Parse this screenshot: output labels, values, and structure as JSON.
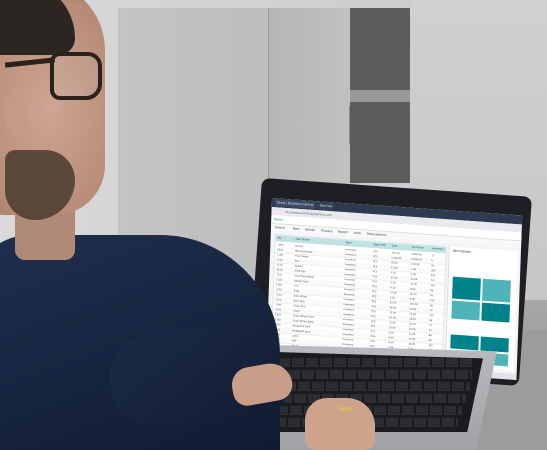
{
  "screen": {
    "browser": {
      "tabs": [
        "Items | Business Central",
        "New tab"
      ],
      "address": "businesscentral.dynamics.com"
    },
    "app": {
      "title": "Items",
      "actions": [
        "Search",
        "New",
        "Delete",
        "Process",
        "Report",
        "Item",
        "More options"
      ]
    },
    "grid": {
      "headers": [
        "No.",
        "Description",
        "Type",
        "Base Unit",
        "Cost",
        "Unit Price",
        "Inventory"
      ],
      "rows": [
        [
          "1000",
          "Bicycle",
          "Inventory",
          "PCS",
          "350.59",
          "4,000.00",
          "15"
        ],
        [
          "1001",
          "Touring Bicycle",
          "Inventory",
          "PCS",
          "1,200.00",
          "5,000.00",
          "8"
        ],
        [
          "1100",
          "Front Wheel",
          "Inventory",
          "PCS",
          "85.00",
          "120.00",
          "40"
        ],
        [
          "1110",
          "Rim",
          "Inventory",
          "PCS",
          "12.50",
          "1.30",
          "200"
        ],
        [
          "1120",
          "Spokes",
          "Inventory",
          "PCS",
          "0.35",
          "2.00",
          "540"
        ],
        [
          "1150",
          "Front Hub",
          "Inventory",
          "PCS",
          "32.00",
          "42.00",
          "74"
        ],
        [
          "1151",
          "Axle Front Wheel",
          "Inventory",
          "PCS",
          "9.50",
          "14.00",
          "120"
        ],
        [
          "1155",
          "Socket Front",
          "Inventory",
          "PCS",
          "4.20",
          "8.00",
          "90"
        ],
        [
          "1160",
          "Tire",
          "Inventory",
          "PCS",
          "18.00",
          "30.00",
          "65"
        ],
        [
          "1170",
          "Tube",
          "Inventory",
          "PCS",
          "3.10",
          "6.00",
          "310"
        ],
        [
          "1200",
          "Back Wheel",
          "Inventory",
          "PCS",
          "90.00",
          "140.00",
          "38"
        ],
        [
          "1250",
          "Back Hub",
          "Inventory",
          "PCS",
          "38.00",
          "50.00",
          "52"
        ],
        [
          "1300",
          "Chain Assy",
          "Inventory",
          "PCS",
          "15.00",
          "25.00",
          "110"
        ],
        [
          "1310",
          "Chain",
          "Inventory",
          "PCS",
          "10.00",
          "18.00",
          "96"
        ],
        [
          "1320",
          "Chain Wheel Front",
          "Inventory",
          "PCS",
          "22.00",
          "35.00",
          "47"
        ],
        [
          "1330",
          "Chain Wheel Back",
          "Inventory",
          "PCS",
          "20.00",
          "32.00",
          "51"
        ],
        [
          "1400",
          "Mudguard front",
          "Inventory",
          "PCS",
          "6.00",
          "12.00",
          "88"
        ],
        [
          "1450",
          "Mudguard back",
          "Inventory",
          "PCS",
          "6.50",
          "13.00",
          "84"
        ],
        [
          "1500",
          "Lamp",
          "Inventory",
          "PCS",
          "9.00",
          "16.00",
          "130"
        ],
        [
          "1600",
          "Bell",
          "Inventory",
          "PCS",
          "2.00",
          "5.00",
          "220"
        ],
        [
          "1700",
          "Brake",
          "Inventory",
          "PCS",
          "14.00",
          "24.00",
          "75"
        ]
      ]
    },
    "factbox": {
      "title": "Item Details"
    }
  }
}
